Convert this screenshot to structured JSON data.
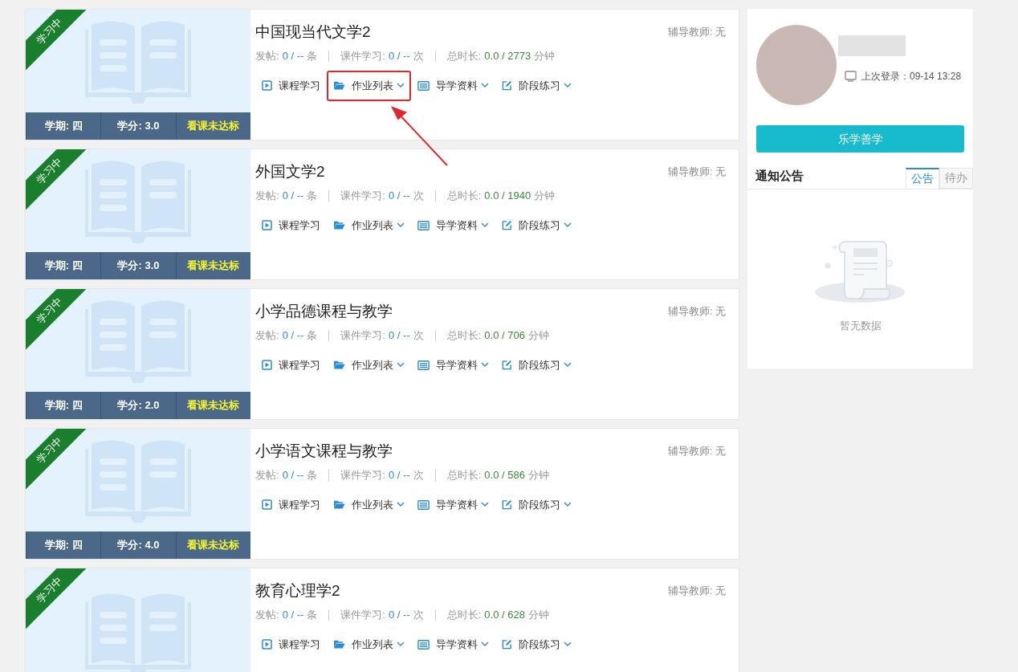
{
  "courses": [
    {
      "badge": "学习中",
      "title": "中国现当代文学2",
      "tutor": "辅导教师: 无",
      "footer": [
        "学期: 四",
        "学分: 3.0",
        "看课未达标"
      ],
      "stats": [
        {
          "label": "发帖:",
          "value": "0 / --",
          "unit": "条"
        },
        {
          "label": "课件学习:",
          "value": "0 / --",
          "unit": "次"
        },
        {
          "label": "总时长:",
          "value": "0.0 / 2773",
          "unit": "分钟"
        }
      ],
      "actions": [
        {
          "label": "课程学习",
          "dropdown": false,
          "highlighted": false
        },
        {
          "label": "作业列表",
          "dropdown": true,
          "highlighted": true
        },
        {
          "label": "导学资料",
          "dropdown": true,
          "highlighted": false
        },
        {
          "label": "阶段练习",
          "dropdown": true,
          "highlighted": false
        }
      ]
    },
    {
      "badge": "学习中",
      "title": "外国文学2",
      "tutor": "辅导教师: 无",
      "footer": [
        "学期: 四",
        "学分: 3.0",
        "看课未达标"
      ],
      "stats": [
        {
          "label": "发帖:",
          "value": "0 / --",
          "unit": "条"
        },
        {
          "label": "课件学习:",
          "value": "0 / --",
          "unit": "次"
        },
        {
          "label": "总时长:",
          "value": "0.0 / 1940",
          "unit": "分钟"
        }
      ],
      "actions": [
        {
          "label": "课程学习",
          "dropdown": false,
          "highlighted": false
        },
        {
          "label": "作业列表",
          "dropdown": true,
          "highlighted": false
        },
        {
          "label": "导学资料",
          "dropdown": true,
          "highlighted": false
        },
        {
          "label": "阶段练习",
          "dropdown": true,
          "highlighted": false
        }
      ]
    },
    {
      "badge": "学习中",
      "title": "小学品德课程与教学",
      "tutor": "辅导教师: 无",
      "footer": [
        "学期: 四",
        "学分: 2.0",
        "看课未达标"
      ],
      "stats": [
        {
          "label": "发帖:",
          "value": "0 / --",
          "unit": "条"
        },
        {
          "label": "课件学习:",
          "value": "0 / --",
          "unit": "次"
        },
        {
          "label": "总时长:",
          "value": "0.0 / 706",
          "unit": "分钟"
        }
      ],
      "actions": [
        {
          "label": "课程学习",
          "dropdown": false,
          "highlighted": false
        },
        {
          "label": "作业列表",
          "dropdown": true,
          "highlighted": false
        },
        {
          "label": "导学资料",
          "dropdown": true,
          "highlighted": false
        },
        {
          "label": "阶段练习",
          "dropdown": true,
          "highlighted": false
        }
      ]
    },
    {
      "badge": "学习中",
      "title": "小学语文课程与教学",
      "tutor": "辅导教师: 无",
      "footer": [
        "学期: 四",
        "学分: 4.0",
        "看课未达标"
      ],
      "stats": [
        {
          "label": "发帖:",
          "value": "0 / --",
          "unit": "条"
        },
        {
          "label": "课件学习:",
          "value": "0 / --",
          "unit": "次"
        },
        {
          "label": "总时长:",
          "value": "0.0 / 586",
          "unit": "分钟"
        }
      ],
      "actions": [
        {
          "label": "课程学习",
          "dropdown": false,
          "highlighted": false
        },
        {
          "label": "作业列表",
          "dropdown": true,
          "highlighted": false
        },
        {
          "label": "导学资料",
          "dropdown": true,
          "highlighted": false
        },
        {
          "label": "阶段练习",
          "dropdown": true,
          "highlighted": false
        }
      ]
    },
    {
      "badge": "学习中",
      "title": "教育心理学2",
      "tutor": "辅导教师: 无",
      "stats": [
        {
          "label": "发帖:",
          "value": "0 / --",
          "unit": "条"
        },
        {
          "label": "课件学习:",
          "value": "0 / --",
          "unit": "次"
        },
        {
          "label": "总时长:",
          "value": "0.0 / 628",
          "unit": "分钟"
        }
      ],
      "actions": [
        {
          "label": "课程学习",
          "dropdown": false,
          "highlighted": false
        },
        {
          "label": "作业列表",
          "dropdown": true,
          "highlighted": false
        },
        {
          "label": "导学资料",
          "dropdown": true,
          "highlighted": false
        },
        {
          "label": "阶段练习",
          "dropdown": true,
          "highlighted": false
        }
      ]
    }
  ],
  "profile": {
    "last_login": "上次登录：09-14 13:28",
    "button": "乐学善学"
  },
  "notices": {
    "title": "通知公告",
    "tabs": [
      {
        "label": "公告",
        "selected": true
      },
      {
        "label": "待办",
        "selected": false
      }
    ],
    "empty": "暂无数据"
  }
}
